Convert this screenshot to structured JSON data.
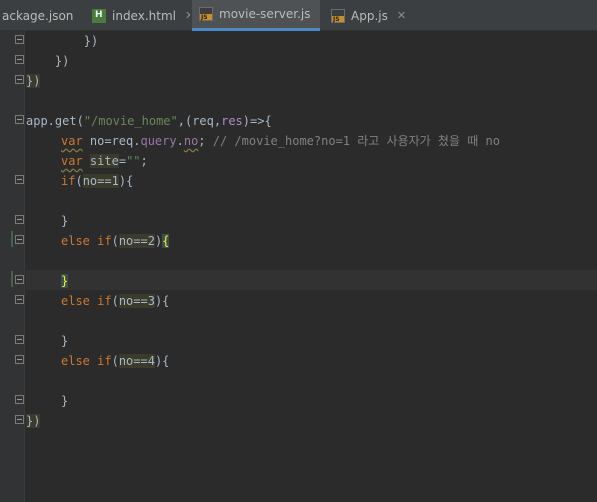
{
  "tabs": [
    {
      "label": "ackage.json",
      "icon": "json-file-icon",
      "active": false
    },
    {
      "label": "index.html",
      "icon": "html-file-icon",
      "active": false
    },
    {
      "label": "movie-server.js",
      "icon": "js-file-icon",
      "active": true
    },
    {
      "label": "App.js",
      "icon": "js-file-icon",
      "active": false
    }
  ],
  "tab_close": "✕",
  "code": {
    "l1": "        })",
    "l2": "    })",
    "l3": "})",
    "l5_a": "app.",
    "l5_b": "get",
    "l5_c": "(",
    "l5_d": "\"/movie_home\"",
    "l5_e": ",(req,",
    "l5_f": "res",
    "l5_g": ")=>{",
    "l6_kw": "var",
    "l6_a": " no=req.",
    "l6_b": "query",
    "l6_c": ".",
    "l6_d": "no",
    "l6_e": "; ",
    "l6_cmt": "// /movie_home?no=1 라고 사용자가 쳤을 때 no",
    "l7_kw": "var",
    "l7_a": " ",
    "l7_b": "site",
    "l7_c": "=",
    "l7_str": "\"\"",
    "l7_d": ";",
    "l8_kw": "if",
    "l8_a": "(",
    "l8_b": "no==",
    "l8_c": "1",
    "l8_d": "){",
    "l10": "}",
    "l11_kw": "else if",
    "l11_a": "(",
    "l11_b": "no==2",
    "l11_c": ")",
    "l11_d": "{",
    "l13": "}",
    "l14_kw": "else if",
    "l14_a": "(",
    "l14_b": "no==3",
    "l14_c": "){",
    "l16": "}",
    "l17_kw": "else if",
    "l17_a": "(",
    "l17_b": "no==4",
    "l17_c": "){",
    "l19": "}",
    "l20_a": "})"
  },
  "colors": {
    "background": "#2b2b2b",
    "keyword": "#cc7832",
    "string": "#6a8759",
    "property": "#9876aa",
    "comment": "#808080",
    "active_tab_underline": "#4a88c7"
  }
}
